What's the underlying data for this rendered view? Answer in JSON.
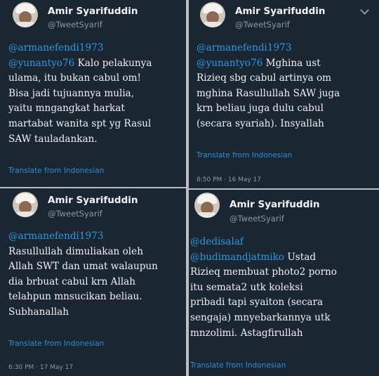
{
  "author": {
    "name": "Amir Syarifuddin",
    "handle": "@TweetSyarif"
  },
  "translate_label": "Translate from Indonesian",
  "tweets": [
    {
      "mentions": [
        "@armanefendi1973",
        "@yunantyo76"
      ],
      "lines": [
        "Kalo pelakunya",
        "ulama, itu bukan cabul om!",
        "Bisa jadi tujuannya mulia,",
        "yaitu mngangkat harkat",
        "martabat wanita spt yg Rasul",
        "SAW tauladankan."
      ],
      "timestamp": ""
    },
    {
      "mentions": [
        "@armanefendi1973",
        "@yunantyo76"
      ],
      "lines": [
        "Mghina ust",
        "Rizieq sbg cabul artinya om",
        "mghina Rasullullah SAW juga",
        "krn beliau juga dulu cabul",
        "(secara syariah). Insyallah"
      ],
      "timestamp": "8:50 PM · 16 May 17"
    },
    {
      "mentions": [
        "@armanefendi1973"
      ],
      "lines": [
        "Rasullullah dimuliakan oleh",
        "Allah SWT dan umat walaupun",
        "dia brbuat cabul krn Allah",
        "telahpun mnsucikan beliau.",
        "Subhanallah"
      ],
      "timestamp": "6:30 PM · 17 May 17"
    },
    {
      "mentions": [
        "@dedisalaf",
        "@budimandjatmiko"
      ],
      "lines": [
        "Ustad",
        "Rizieq membuat photo2 porno",
        "itu semata2 utk koleksi",
        "pribadi tapi syaiton (secara",
        "sengaja) mnyebarkannya utk",
        "mnzolimi. Astagfirullah"
      ],
      "timestamp": ""
    }
  ]
}
